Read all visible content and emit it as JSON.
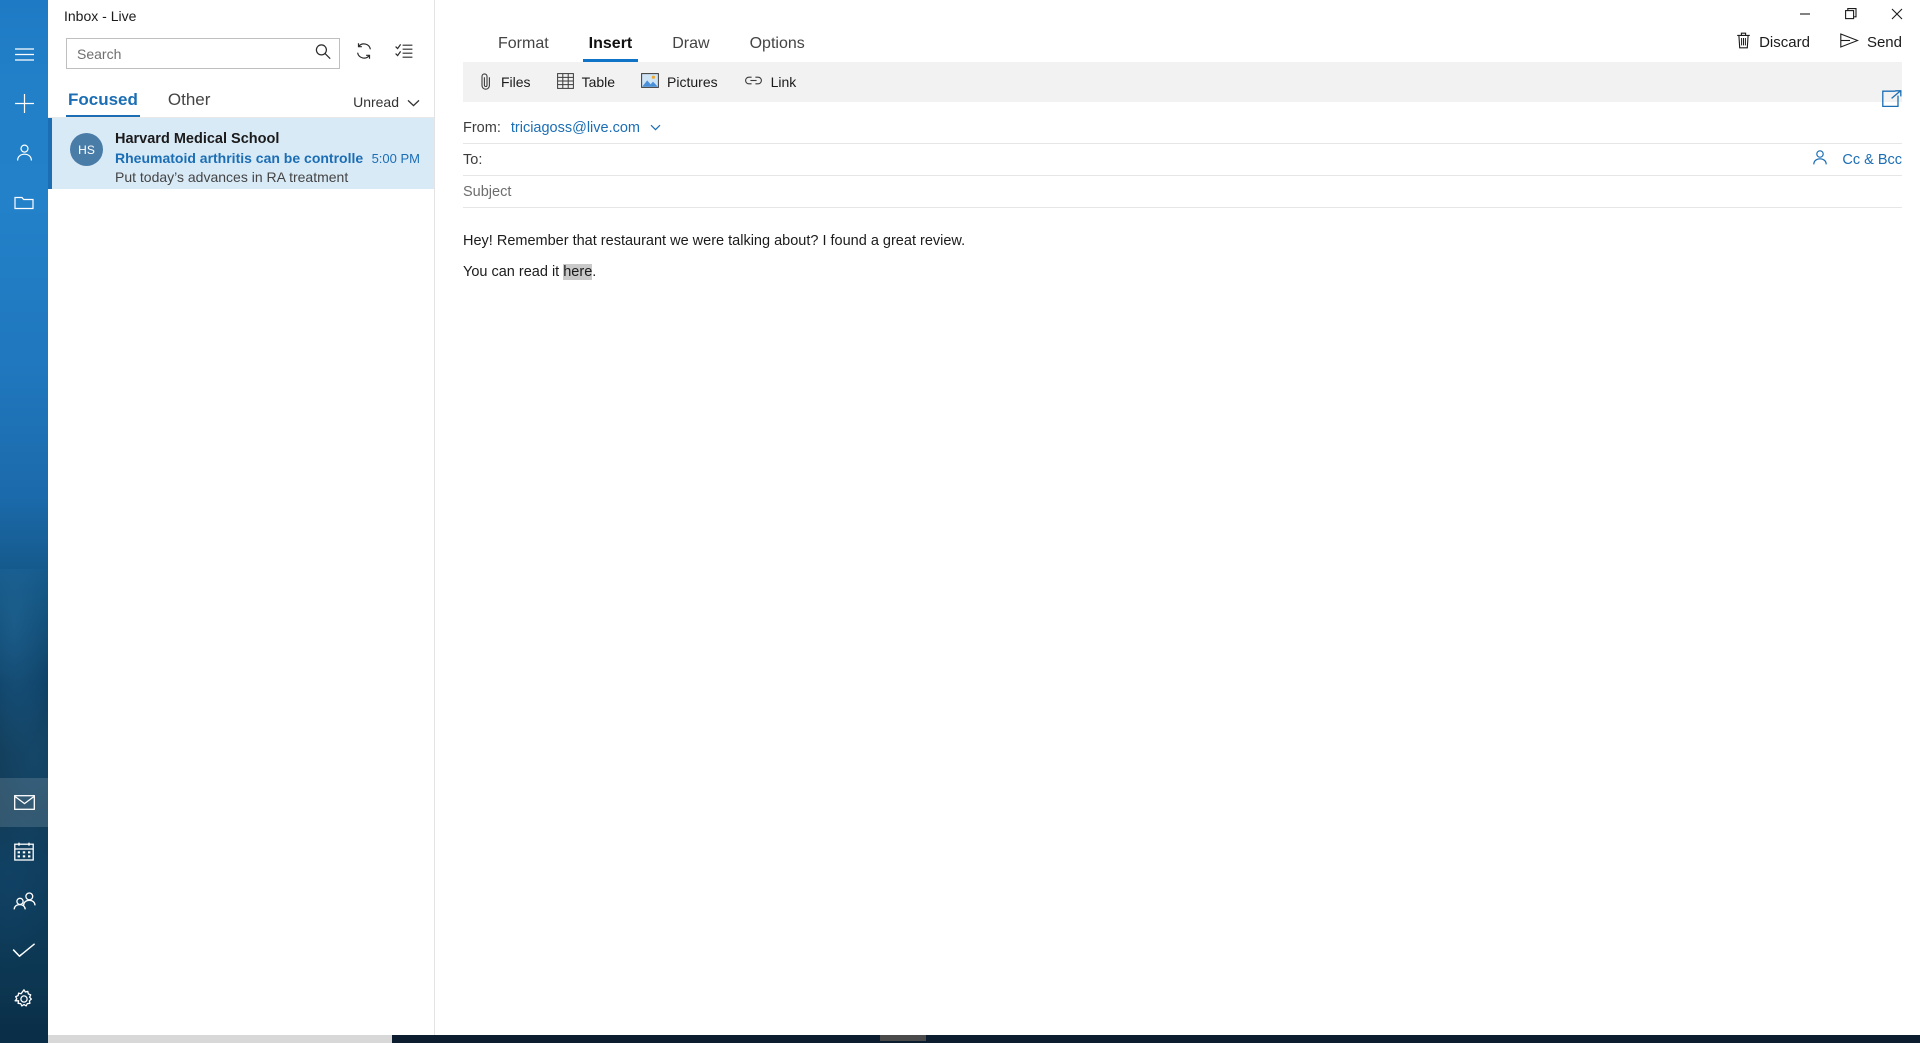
{
  "window": {
    "title": "Inbox - Live",
    "controls": [
      {
        "name": "minimize",
        "glyph": "minimize-icon"
      },
      {
        "name": "maximize",
        "glyph": "maximize-icon"
      },
      {
        "name": "close",
        "glyph": "close-icon"
      }
    ]
  },
  "rail": {
    "top_items": [
      {
        "name": "hamburger-menu",
        "icon": "hamburger-icon"
      },
      {
        "name": "new-mail",
        "icon": "plus-icon"
      },
      {
        "name": "people",
        "icon": "person-icon"
      },
      {
        "name": "folders",
        "icon": "folder-icon"
      }
    ],
    "bottom_items": [
      {
        "name": "mail",
        "icon": "mail-icon",
        "selected": true
      },
      {
        "name": "calendar",
        "icon": "calendar-icon",
        "selected": false
      },
      {
        "name": "people",
        "icon": "people-icon",
        "selected": false
      },
      {
        "name": "tasks",
        "icon": "checkmark-icon",
        "selected": false
      },
      {
        "name": "settings",
        "icon": "gear-icon",
        "selected": false
      }
    ]
  },
  "list_pane": {
    "search": {
      "placeholder": "Search",
      "value": "",
      "icon": "search-icon"
    },
    "toolbar": [
      {
        "name": "sync",
        "icon": "refresh-icon"
      },
      {
        "name": "select-mode",
        "icon": "checklist-icon"
      }
    ],
    "pivots": [
      {
        "label": "Focused",
        "active": true
      },
      {
        "label": "Other",
        "active": false
      }
    ],
    "filter": {
      "label": "Unread",
      "chevron": "chevron-down-icon"
    },
    "messages": [
      {
        "initials": "HS",
        "sender": "Harvard Medical School",
        "subject": "Rheumatoid arthritis can be controlle",
        "time": "5:00 PM",
        "preview": "Put today’s advances in RA treatment",
        "selected": true
      }
    ]
  },
  "compose": {
    "tabs": [
      {
        "label": "Format",
        "active": false
      },
      {
        "label": "Insert",
        "active": true
      },
      {
        "label": "Draw",
        "active": false
      },
      {
        "label": "Options",
        "active": false
      }
    ],
    "actions": [
      {
        "label": "Discard",
        "icon": "trash-icon"
      },
      {
        "label": "Send",
        "icon": "send-icon"
      }
    ],
    "ribbon": [
      {
        "label": "Files",
        "icon": "paperclip-icon"
      },
      {
        "label": "Table",
        "icon": "table-icon"
      },
      {
        "label": "Pictures",
        "icon": "picture-icon"
      },
      {
        "label": "Link",
        "icon": "link-icon"
      }
    ],
    "fields": {
      "from_label": "From:",
      "from_value": "triciagoss@live.com",
      "from_chevron": "chevron-down-icon",
      "to_label": "To:",
      "to_value": "",
      "cc_bcc_label": "Cc & Bcc",
      "address_book_icon": "person-icon",
      "subject_placeholder": "Subject",
      "subject_value": "",
      "popout_icon": "popout-icon"
    },
    "body": {
      "paragraph1": "Hey! Remember that restaurant we were talking about? I found a great review.",
      "paragraph2_before": "You can read it ",
      "paragraph2_selected": "here",
      "paragraph2_after": "."
    }
  },
  "colors": {
    "accent": "#1b6eb4",
    "tab_underline": "#0f73c8",
    "selected_row": "#d9eaf7",
    "ribbon_bg": "#f2f2f2",
    "selection_highlight": "#c9c9c9"
  }
}
